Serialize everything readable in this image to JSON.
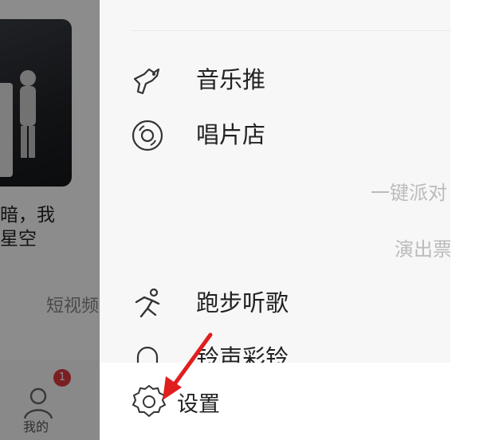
{
  "background": {
    "song_text": [
      "暗，我",
      "星空"
    ],
    "short_video_label": "短视频",
    "me_tab_label": "我的",
    "badge_count": "1"
  },
  "drawer": {
    "menu": [
      {
        "label": "音乐推",
        "icon": "music-push-icon"
      },
      {
        "label": "唱片店",
        "icon": "record-store-icon"
      },
      {
        "label": "跑步听歌",
        "icon": "running-icon"
      },
      {
        "label": "铃声彩铃",
        "icon": "bell-icon"
      }
    ],
    "right_texts": [
      "一键派对",
      "演出票"
    ],
    "settings_label": "设置"
  },
  "colors": {
    "accent_red": "#e0383e",
    "overlay": "rgba(0,0,0,0.45)"
  }
}
